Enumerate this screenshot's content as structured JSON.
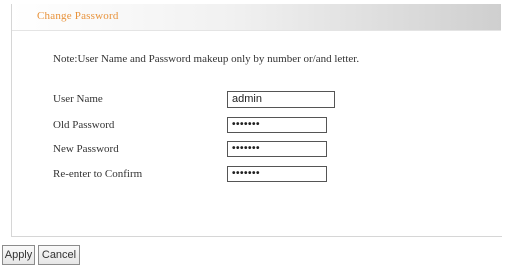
{
  "panel": {
    "title": "Change Password"
  },
  "note": "Note:User Name and Password makeup only by number or/and letter.",
  "form": {
    "username": {
      "label": "User Name",
      "value": "admin"
    },
    "old_password": {
      "label": "Old Password",
      "value": "•••••••"
    },
    "new_password": {
      "label": "New Password",
      "value": "•••••••"
    },
    "confirm_password": {
      "label": "Re-enter to Confirm",
      "value": "•••••••"
    }
  },
  "buttons": {
    "apply": "Apply",
    "cancel": "Cancel"
  },
  "colors": {
    "title": "#e8923a",
    "text": "#333333"
  }
}
